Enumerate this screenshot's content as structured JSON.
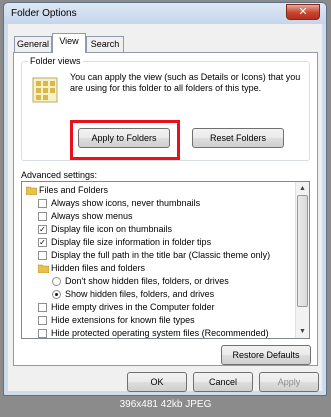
{
  "window": {
    "title": "Folder Options",
    "close_glyph": "✕"
  },
  "tabs": [
    {
      "label": "General"
    },
    {
      "label": "View"
    },
    {
      "label": "Search"
    }
  ],
  "folder_views": {
    "legend": "Folder views",
    "description": "You can apply the view (such as Details or Icons) that you are using for this folder to all folders of this type.",
    "apply_label": "Apply to Folders",
    "reset_label": "Reset Folders",
    "highlight_color": "#e8111b"
  },
  "advanced": {
    "label": "Advanced settings:",
    "items": [
      {
        "type": "folder",
        "text": "Files and Folders"
      },
      {
        "type": "checkbox",
        "checked": false,
        "text": "Always show icons, never thumbnails"
      },
      {
        "type": "checkbox",
        "checked": false,
        "text": "Always show menus"
      },
      {
        "type": "checkbox",
        "checked": true,
        "text": "Display file icon on thumbnails"
      },
      {
        "type": "checkbox",
        "checked": true,
        "text": "Display file size information in folder tips"
      },
      {
        "type": "checkbox",
        "checked": false,
        "text": "Display the full path in the title bar (Classic theme only)"
      },
      {
        "type": "folder",
        "text": "Hidden files and folders"
      },
      {
        "type": "radio",
        "checked": false,
        "text": "Don't show hidden files, folders, or drives"
      },
      {
        "type": "radio",
        "checked": true,
        "text": "Show hidden files, folders, and drives"
      },
      {
        "type": "checkbox",
        "checked": false,
        "text": "Hide empty drives in the Computer folder"
      },
      {
        "type": "checkbox",
        "checked": false,
        "text": "Hide extensions for known file types"
      },
      {
        "type": "checkbox",
        "checked": false,
        "text": "Hide protected operating system files (Recommended)"
      }
    ],
    "restore_label": "Restore Defaults"
  },
  "buttons": {
    "ok": "OK",
    "cancel": "Cancel",
    "apply": "Apply"
  },
  "caption": "396x481 42kb JPEG"
}
